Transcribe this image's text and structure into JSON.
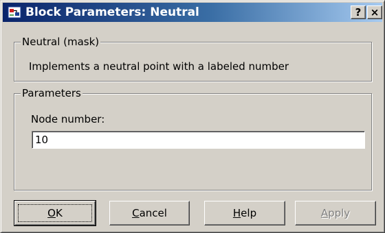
{
  "window": {
    "title": "Block Parameters: Neutral",
    "help_glyph": "?",
    "close_glyph": "×"
  },
  "mask_group": {
    "legend": "Neutral (mask)",
    "description": "Implements a neutral point with a labeled number"
  },
  "params_group": {
    "legend": "Parameters",
    "node_label": "Node number:",
    "node_value": "10"
  },
  "buttons": {
    "ok": {
      "mnemonic": "O",
      "rest": "K",
      "enabled": true
    },
    "cancel": {
      "mnemonic": "C",
      "rest": "ancel",
      "enabled": true
    },
    "help": {
      "mnemonic": "H",
      "rest": "elp",
      "enabled": true
    },
    "apply": {
      "mnemonic": "A",
      "rest": "pply",
      "enabled": false
    }
  },
  "colors": {
    "titlebar_start": "#0a246a",
    "titlebar_end": "#a6caf0",
    "face": "#d4d0c8"
  }
}
